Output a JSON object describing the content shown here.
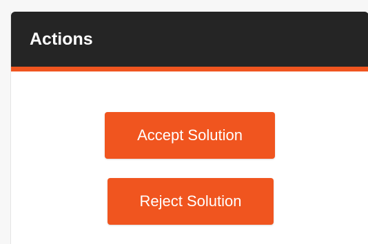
{
  "panel": {
    "title": "Actions"
  },
  "actions": {
    "accept_label": "Accept Solution",
    "reject_label": "Reject Solution"
  },
  "colors": {
    "header_background": "#252525",
    "accent": "#f0551f",
    "button_text": "#ffffff"
  }
}
